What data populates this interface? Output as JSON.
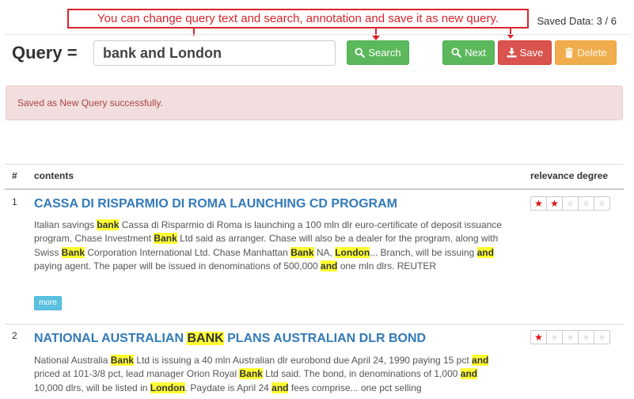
{
  "annotation": {
    "text": "You can change query text and search, annotation and save it as new query.",
    "color": "#d9242c"
  },
  "status": {
    "saved_label": "Saved Data:",
    "saved_current": "3",
    "saved_separator": "/",
    "saved_total": "6"
  },
  "query": {
    "label": "Query =",
    "value": "bank and London"
  },
  "toolbar": {
    "search_label": "Search",
    "next_label": "Next",
    "save_label": "Save",
    "delete_label": "Delete"
  },
  "alert": {
    "message": "Saved as New Query successfully."
  },
  "table": {
    "headers": {
      "num": "#",
      "contents": "contents",
      "relevance": "relevance degree"
    },
    "rows": [
      {
        "num": "1",
        "title": [
          {
            "t": "CASSA DI RISPARMIO DI ROMA LAUNCHING CD PROGRAM",
            "hl": false
          }
        ],
        "text": [
          {
            "t": "Italian savings ",
            "hl": false
          },
          {
            "t": "bank",
            "hl": true
          },
          {
            "t": " Cassa di Risparmio di Roma is launching a 100 mln dlr euro-certificate of deposit issuance program, Chase Investment ",
            "hl": false
          },
          {
            "t": "Bank",
            "hl": true
          },
          {
            "t": " Ltd said as arranger. Chase will also be a dealer for the program, along with Swiss ",
            "hl": false
          },
          {
            "t": "Bank",
            "hl": true
          },
          {
            "t": " Corporation International Ltd. Chase Manhattan ",
            "hl": false
          },
          {
            "t": "Bank",
            "hl": true
          },
          {
            "t": " NA, ",
            "hl": false
          },
          {
            "t": "London",
            "hl": true
          },
          {
            "t": "... Branch, will be issuing ",
            "hl": false
          },
          {
            "t": "and",
            "hl": true
          },
          {
            "t": " paying agent. The paper will be issued in denominations of 500,000 ",
            "hl": false
          },
          {
            "t": "and",
            "hl": true
          },
          {
            "t": " one mln dlrs. REUTER",
            "hl": false
          }
        ],
        "more_label": "more",
        "rating": 2,
        "max_rating": 5
      },
      {
        "num": "2",
        "title": [
          {
            "t": "NATIONAL AUSTRALIAN ",
            "hl": false
          },
          {
            "t": "BANK",
            "hl": true
          },
          {
            "t": " PLANS AUSTRALIAN DLR BOND",
            "hl": false
          }
        ],
        "text": [
          {
            "t": "National Australia ",
            "hl": false
          },
          {
            "t": "Bank",
            "hl": true
          },
          {
            "t": " Ltd is issuing a 40 mln Australian dlr eurobond due April 24, 1990 paying 15 pct ",
            "hl": false
          },
          {
            "t": "and",
            "hl": true
          },
          {
            "t": " priced at 101-3/8 pct, lead manager Orion Royal ",
            "hl": false
          },
          {
            "t": "Bank",
            "hl": true
          },
          {
            "t": " Ltd said. The bond, in denominations of 1,000 ",
            "hl": false
          },
          {
            "t": "and",
            "hl": true
          },
          {
            "t": " 10,000 dlrs, will be listed in ",
            "hl": false
          },
          {
            "t": "London",
            "hl": true
          },
          {
            "t": ". Paydate is April 24 ",
            "hl": false
          },
          {
            "t": "and",
            "hl": true
          },
          {
            "t": " fees comprise... one pct selling",
            "hl": false
          }
        ],
        "rating": 1,
        "max_rating": 5
      }
    ]
  },
  "icons": {
    "search": "search-icon",
    "next": "search-icon",
    "save": "download-icon",
    "delete": "trash-icon",
    "star": "star-icon"
  },
  "colors": {
    "success": "#5cb85c",
    "danger": "#d9534f",
    "warning": "#f0ad4e",
    "info": "#5bc0de",
    "link": "#337ab7",
    "highlight": "#ffff33",
    "star_on": "#e01010"
  }
}
